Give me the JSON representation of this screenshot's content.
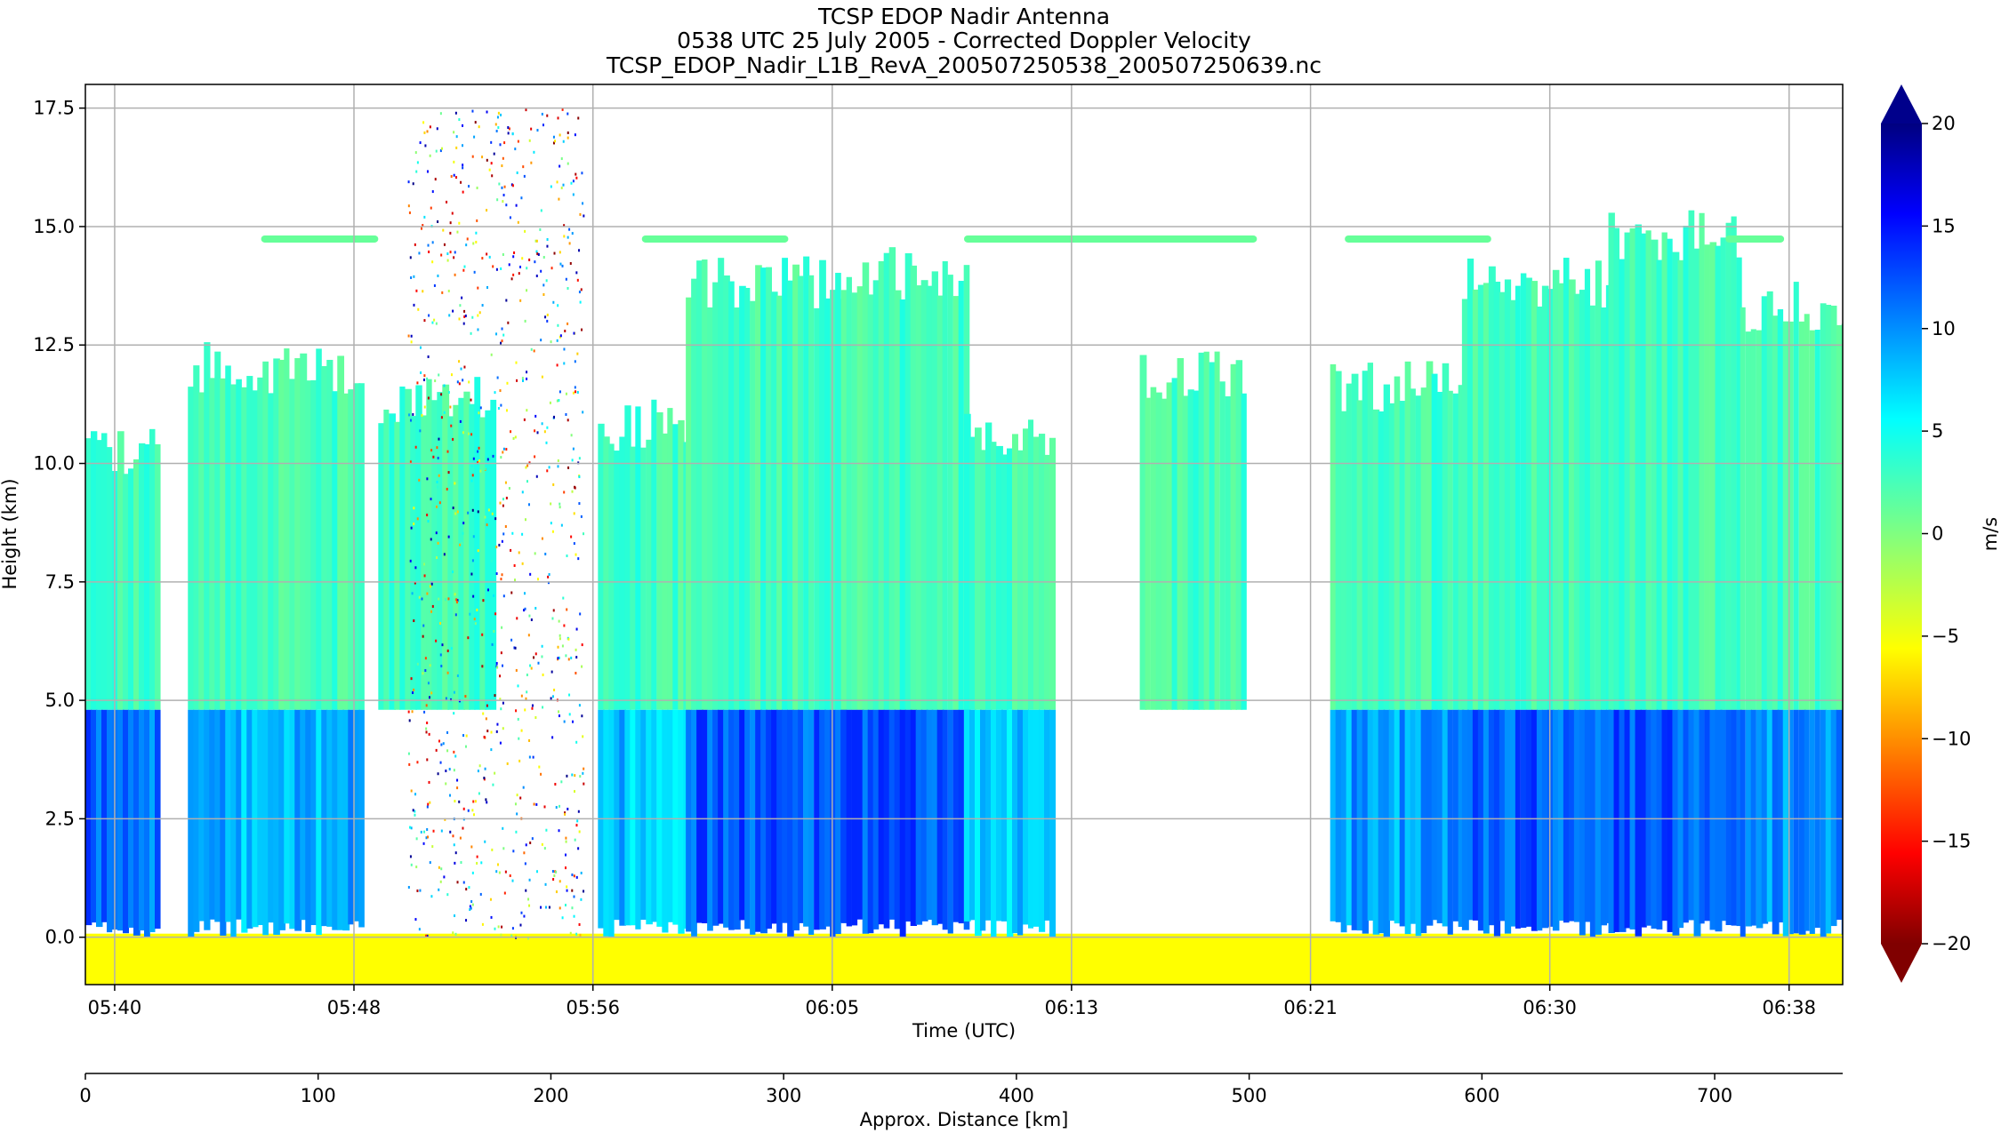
{
  "chart_data": {
    "type": "heatmap",
    "title_lines": [
      "TCSP EDOP Nadir Antenna",
      "0538 UTC 25 July 2005 - Corrected Doppler Velocity",
      "TCSP_EDOP_Nadir_L1B_RevA_200507250538_200507250639.nc"
    ],
    "xlabel": "Time (UTC)",
    "ylabel": "Height (km)",
    "x2label": "Approx. Distance [km]",
    "colorbar_label": "m/s",
    "colormap": "jet",
    "colorbar_range": [
      -20,
      20
    ],
    "colorbar_extend": "both",
    "colorbar_ticks": [
      20,
      15,
      10,
      5,
      0,
      -5,
      -10,
      -15,
      -20
    ],
    "colorbar_tick_labels": [
      "20",
      "15",
      "10",
      "5",
      "0",
      "−5",
      "−10",
      "−15",
      "−20"
    ],
    "ylim": [
      -1,
      18
    ],
    "yticks": [
      0.0,
      2.5,
      5.0,
      7.5,
      10.0,
      12.5,
      15.0,
      17.5
    ],
    "ytick_labels": [
      "0.0",
      "2.5",
      "5.0",
      "7.5",
      "10.0",
      "12.5",
      "15.0",
      "17.5"
    ],
    "xlim_minutes": [
      0,
      60
    ],
    "xtick_positions_minutes": [
      1,
      9.17,
      17.33,
      25.5,
      33.67,
      41.83,
      50,
      58.17
    ],
    "xtick_labels": [
      "05:40",
      "05:48",
      "05:56",
      "06:05",
      "06:13",
      "06:21",
      "06:30",
      "06:38"
    ],
    "distance_lim": [
      0,
      755
    ],
    "distance_ticks": [
      0,
      100,
      200,
      300,
      400,
      500,
      600,
      700
    ],
    "distance_tick_labels": [
      "0",
      "100",
      "200",
      "300",
      "400",
      "500",
      "600",
      "700"
    ],
    "grid": true,
    "features": {
      "melting_layer_km": 4.8,
      "surface_km": 0.0,
      "echo_top_max_km": 15.0,
      "bright_band_velocity_ms": 7,
      "cloud_velocity_ms": 1,
      "surface_velocity_ms": -5
    }
  }
}
